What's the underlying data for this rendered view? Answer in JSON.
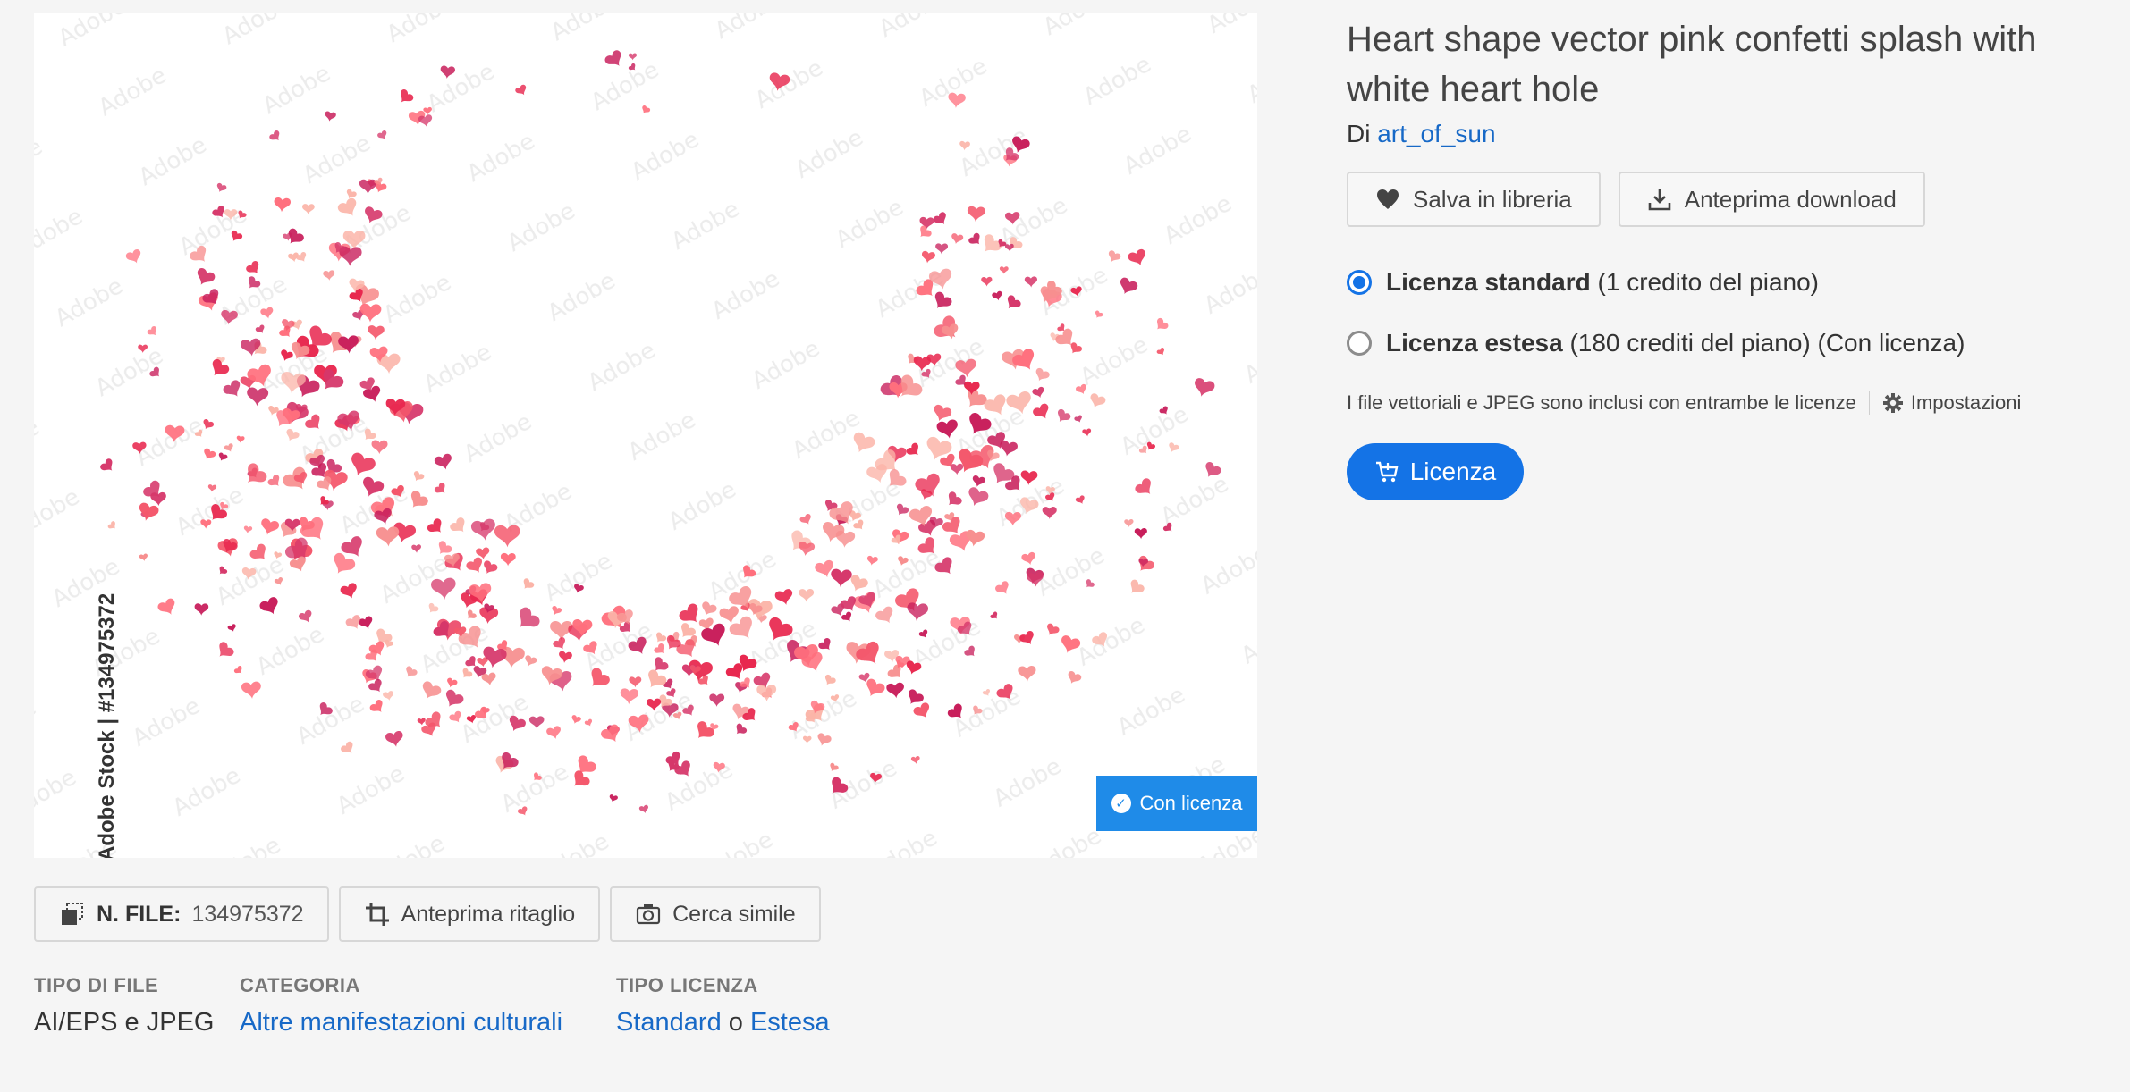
{
  "preview": {
    "watermark_id": "Adobe Stock | #134975372",
    "badge_label": "Con licenza"
  },
  "tools": {
    "file_label": "N. FILE:",
    "file_number": "134975372",
    "crop_label": "Anteprima ritaglio",
    "similar_label": "Cerca simile"
  },
  "meta": {
    "file_type_label": "TIPO DI FILE",
    "file_type_value": "AI/EPS e JPEG",
    "category_label": "CATEGORIA",
    "category_value": "Altre manifestazioni culturali",
    "license_type_label": "TIPO LICENZA",
    "license_standard": "Standard",
    "license_or": "o",
    "license_extended": "Estesa"
  },
  "panel": {
    "title": "Heart shape vector pink confetti splash with white heart hole",
    "author_prefix": "Di",
    "author_name": "art_of_sun",
    "save_label": "Salva in libreria",
    "download_label": "Anteprima download",
    "license_standard_name": "Licenza standard",
    "license_standard_detail": "(1 credito del piano)",
    "license_extended_name": "Licenza estesa",
    "license_extended_detail": "(180 crediti del piano) (Con licenza)",
    "info_text": "I file vettoriali e JPEG sono inclusi con entrambe le licenze",
    "settings_label": "Impostazioni",
    "cta_label": "Licenza"
  },
  "colors": {
    "accent": "#1473e6",
    "badge": "#1f8be8",
    "link": "#1769c7",
    "heart_palette": [
      "#e8284f",
      "#c81e5b",
      "#f4576b",
      "#f78f8f",
      "#fbb4a8",
      "#d6376a",
      "#ff6f7d"
    ]
  }
}
